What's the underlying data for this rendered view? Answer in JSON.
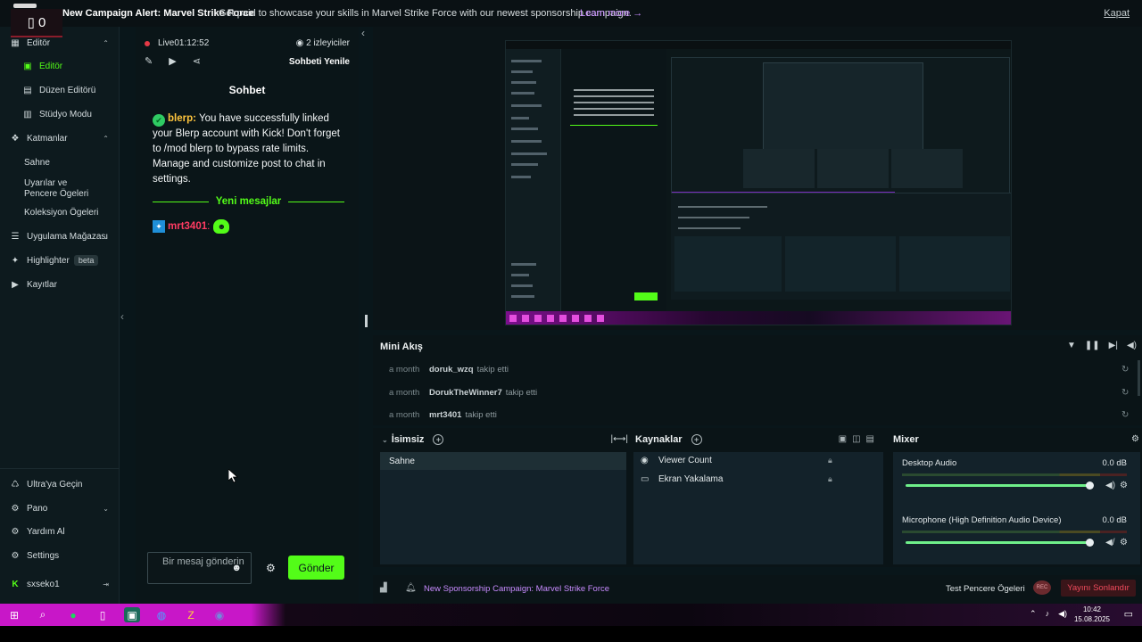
{
  "banner": {
    "title": "New Campaign Alert: Marvel Strike Force",
    "text": "Get paid to showcase your skills in Marvel Strike Force with our newest sponsorship campaign.",
    "link": "Learn more →",
    "close": "Kapat",
    "counter": "▯ 0"
  },
  "nav": {
    "items": [
      {
        "label": "Editör",
        "icon": "▦",
        "chev": "⌃"
      },
      {
        "label": "Editör",
        "icon": "▣"
      },
      {
        "label": "Düzen Editörü",
        "icon": "▤"
      },
      {
        "label": "Stüdyo Modu",
        "icon": "▥"
      },
      {
        "label": "Katmanlar",
        "icon": "❖",
        "chev": "⌃"
      },
      {
        "label": "Sahne"
      },
      {
        "label": "Uyarılar ve Pencere Ögeleri"
      },
      {
        "label": "Koleksiyon Ögeleri"
      },
      {
        "label": "Uygulama Mağazası",
        "icon": "☰",
        "chev": "⌄"
      },
      {
        "label": "Highlighter",
        "icon": "✦",
        "badge": "beta"
      },
      {
        "label": "Kayıtlar",
        "icon": "▶"
      },
      {
        "label": "Ultra'ya Geçin",
        "icon": "♺"
      },
      {
        "label": "Pano",
        "icon": "⚙",
        "chev": "⌄"
      },
      {
        "label": "Yardım Al",
        "icon": "⚙"
      },
      {
        "label": "Settings",
        "icon": "⚙"
      },
      {
        "label": "sxseko1",
        "icon": "K",
        "end": "⇥"
      }
    ]
  },
  "chat": {
    "live": "Live01:12:52",
    "viewers": "◉ 2 izleyiciler",
    "refresh": "Sohbeti Yenile",
    "title": "Sohbet",
    "msg_user": "blerp:",
    "msg_text": "You have successfully linked your Blerp account with Kick! Don't forget to /mod blerp to bypass rate limits. Manage and customize post to chat in settings.",
    "new_messages": "Yeni mesajlar",
    "user2": "mrt3401",
    "user2_colon": ":",
    "input_placeholder": "Bir mesaj gönderin",
    "send": "Gönder"
  },
  "mini": {
    "title": "Mini Akış",
    "rows": [
      {
        "time": "a month",
        "who": "doruk_wzq",
        "act": "takip etti"
      },
      {
        "time": "a month",
        "who": "DorukTheWinner7",
        "act": "takip etti"
      },
      {
        "time": "a month",
        "who": "mrt3401",
        "act": "takip etti"
      }
    ]
  },
  "scenes": {
    "title": "İsimsiz",
    "item": "Sahne"
  },
  "sources": {
    "title": "Kaynaklar",
    "items": [
      {
        "label": "Viewer Count",
        "icon": "◉"
      },
      {
        "label": "Ekran Yakalama",
        "icon": "▭"
      }
    ]
  },
  "mixer": {
    "title": "Mixer",
    "channels": [
      {
        "name": "Desktop Audio",
        "db": "0.0 dB"
      },
      {
        "name": "Microphone (High Definition Audio Device)",
        "db": "0.0 dB"
      }
    ]
  },
  "status": {
    "link": "New Sponsorship Campaign: Marvel Strike Force",
    "test": "Test Pencere Ögeleri",
    "rec": "REC",
    "stop": "Yayını Sonlandır"
  },
  "taskbar": {
    "time": "10:42",
    "date": "15.08.2025"
  }
}
